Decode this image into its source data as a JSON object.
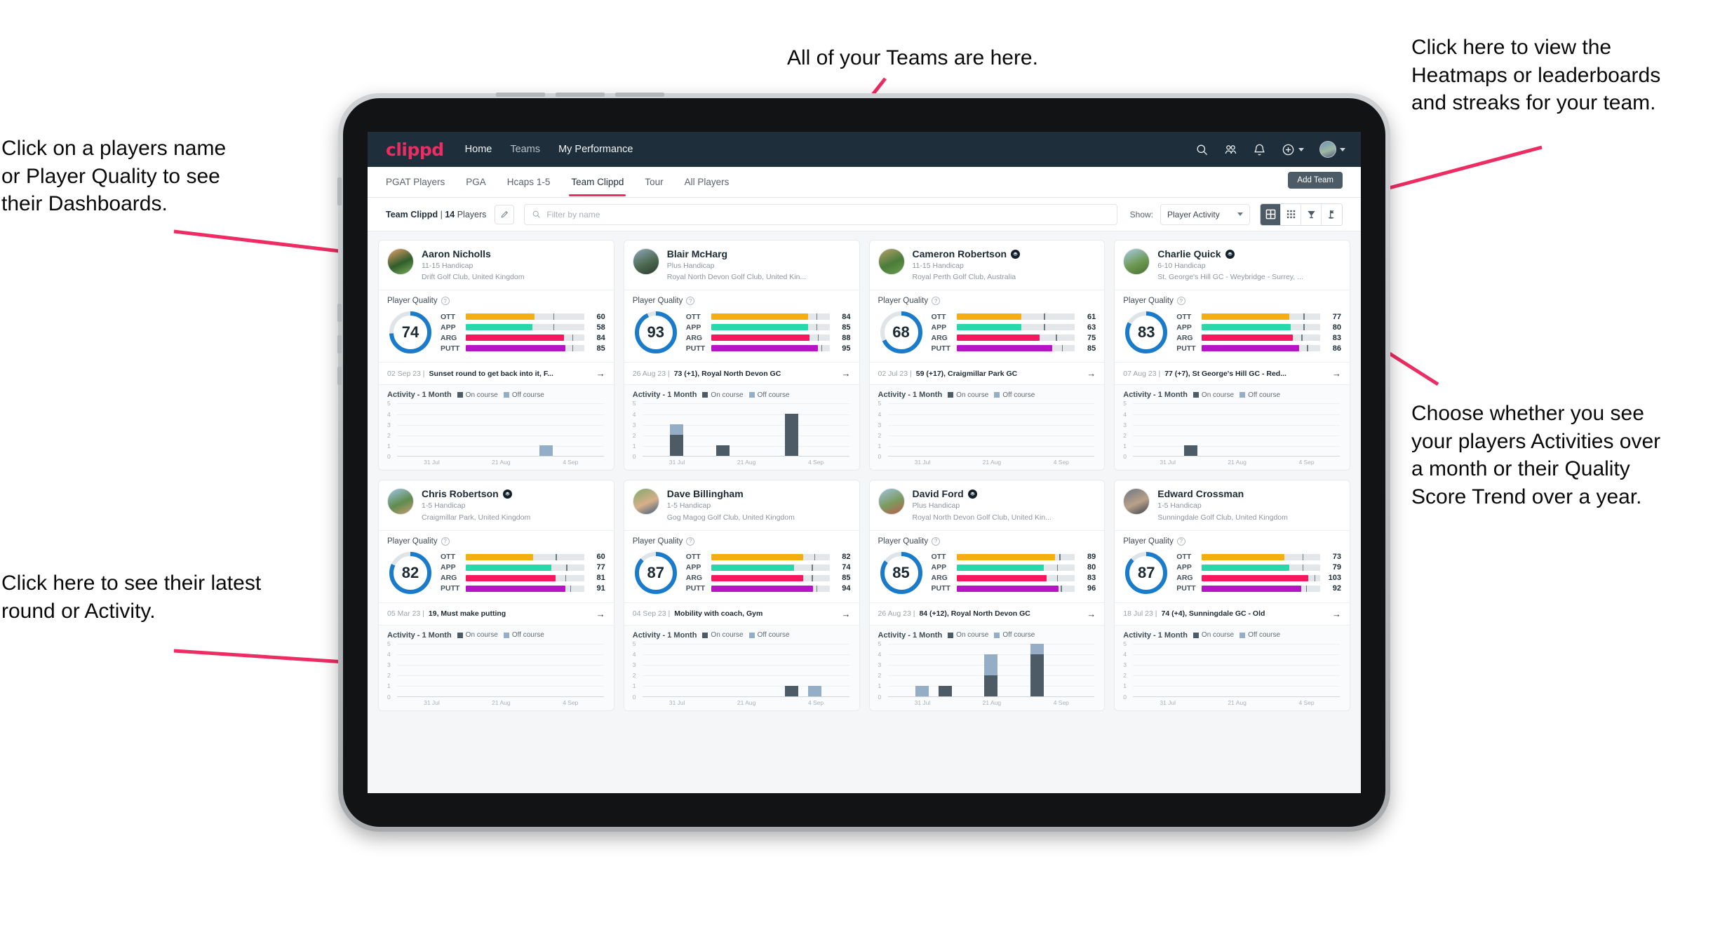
{
  "annotations": {
    "left_top": "Click on a players name\nor Player Quality to see\ntheir Dashboards.",
    "left_bottom": "Click here to see their latest\nround or Activity.",
    "top": "All of your Teams are here.",
    "right_top": "Click here to view the\nHeatmaps or leaderboards\nand streaks for your team.",
    "right_bottom": "Choose whether you see\nyour players Activities over\na month or their Quality\nScore Trend over a year.",
    "arrow_color": "#ec2c62"
  },
  "app": {
    "brand": "clippd",
    "nav_links": [
      {
        "label": "Home",
        "active": true
      },
      {
        "label": "Teams",
        "active": false
      },
      {
        "label": "My Performance",
        "active": false
      }
    ],
    "nav_icons": [
      "search-icon",
      "people-icon",
      "bell-icon",
      "plus-circle-icon",
      "avatar"
    ],
    "tabs": [
      {
        "label": "PGAT Players",
        "active": false
      },
      {
        "label": "PGA",
        "active": false
      },
      {
        "label": "Hcaps 1-5",
        "active": false
      },
      {
        "label": "Team Clippd",
        "active": true
      },
      {
        "label": "Tour",
        "active": false
      },
      {
        "label": "All Players",
        "active": false
      }
    ],
    "add_team_label": "Add Team",
    "filter": {
      "team_name": "Team Clippd",
      "separator": "|",
      "player_count": "14",
      "players_word": "Players",
      "edit_icon": "pencil-icon",
      "search_placeholder": "Filter by name",
      "search_value": "",
      "show_label": "Show:",
      "show_value": "Player Activity",
      "view_toggles": [
        "grid-large-icon",
        "grid-small-icon",
        "shield-icon",
        "flag-icon"
      ],
      "active_view": 0
    },
    "accent_color": "#ec2c62",
    "navbar_color": "#1e2e3b"
  },
  "quality_colors": {
    "OTT": "#f5ae11",
    "APP": "#2ad7ab",
    "ARG": "#f5185e",
    "PUTT": "#b515c4",
    "ring": "#1b7bcb",
    "track": "#e3e7ea"
  },
  "chart_data": {
    "type": "bar",
    "title": "Activity - 1 Month",
    "legend": [
      "On course",
      "Off course"
    ],
    "legend_colors": [
      "#4c5b66",
      "#93aec6"
    ],
    "ylim": [
      0,
      5
    ],
    "yticks": [
      5,
      4,
      3,
      2,
      1,
      0
    ],
    "xlabels": [
      "31 Jul",
      "21 Aug",
      "4 Sep"
    ],
    "bins": 9,
    "grid": true,
    "series_per_player": [
      {
        "player": "Aaron Nicholls",
        "on_course": [
          0,
          0,
          0,
          0,
          0,
          0,
          0,
          0,
          0
        ],
        "off_course": [
          0,
          0,
          0,
          0,
          0,
          0,
          1,
          0,
          0
        ]
      },
      {
        "player": "Blair McHarg",
        "on_course": [
          0,
          2,
          0,
          1,
          0,
          0,
          4,
          0,
          0
        ],
        "off_course": [
          0,
          1,
          0,
          0,
          0,
          0,
          0,
          0,
          0
        ]
      },
      {
        "player": "Cameron Robertson",
        "on_course": [
          0,
          0,
          0,
          0,
          0,
          0,
          0,
          0,
          0
        ],
        "off_course": [
          0,
          0,
          0,
          0,
          0,
          0,
          0,
          0,
          0
        ]
      },
      {
        "player": "Charlie Quick",
        "on_course": [
          0,
          0,
          1,
          0,
          0,
          0,
          0,
          0,
          0
        ],
        "off_course": [
          0,
          0,
          0,
          0,
          0,
          0,
          0,
          0,
          0
        ]
      },
      {
        "player": "Chris Robertson",
        "on_course": [
          0,
          0,
          0,
          0,
          0,
          0,
          0,
          0,
          0
        ],
        "off_course": [
          0,
          0,
          0,
          0,
          0,
          0,
          0,
          0,
          0
        ]
      },
      {
        "player": "Dave Billingham",
        "on_course": [
          0,
          0,
          0,
          0,
          0,
          0,
          1,
          0,
          0
        ],
        "off_course": [
          0,
          0,
          0,
          0,
          0,
          0,
          0,
          1,
          0
        ]
      },
      {
        "player": "David Ford",
        "on_course": [
          0,
          0,
          1,
          0,
          2,
          0,
          4,
          0,
          0
        ],
        "off_course": [
          0,
          1,
          0,
          0,
          2,
          0,
          1,
          0,
          0
        ]
      },
      {
        "player": "Edward Crossman",
        "on_course": [
          0,
          0,
          0,
          0,
          0,
          0,
          0,
          0,
          0
        ],
        "off_course": [
          0,
          0,
          0,
          0,
          0,
          0,
          0,
          0,
          0
        ]
      }
    ]
  },
  "players": [
    {
      "name": "Aaron Nicholls",
      "verified": false,
      "handicap": "11-15 Handicap",
      "club": "Drift Golf Club, United Kingdom",
      "avatar_colors": [
        "#e8a06a",
        "#2f5e2c",
        "#7fae5a"
      ],
      "quality_label": "Player Quality",
      "score": 74,
      "metrics": [
        {
          "label": "OTT",
          "value": 60,
          "fill": 58,
          "tick": 74
        },
        {
          "label": "APP",
          "value": 58,
          "fill": 56,
          "tick": 74
        },
        {
          "label": "ARG",
          "value": 84,
          "fill": 83,
          "tick": 90
        },
        {
          "label": "PUTT",
          "value": 85,
          "fill": 84,
          "tick": 90
        }
      ],
      "last_date": "02 Sep 23 |",
      "last_text": "Sunset round to get back into it, F..."
    },
    {
      "name": "Blair McHarg",
      "verified": false,
      "handicap": "Plus Handicap",
      "club": "Royal North Devon Golf Club, United Kin...",
      "avatar_colors": [
        "#8fa7bb",
        "#4d6a52",
        "#2b3b33"
      ],
      "quality_label": "Player Quality",
      "score": 93,
      "metrics": [
        {
          "label": "OTT",
          "value": 84,
          "fill": 82,
          "tick": 89
        },
        {
          "label": "APP",
          "value": 85,
          "fill": 82,
          "tick": 89
        },
        {
          "label": "ARG",
          "value": 88,
          "fill": 83,
          "tick": 90
        },
        {
          "label": "PUTT",
          "value": 95,
          "fill": 90,
          "tick": 93
        }
      ],
      "last_date": "26 Aug 23 |",
      "last_text": "73 (+1), Royal North Devon GC"
    },
    {
      "name": "Cameron Robertson",
      "verified": true,
      "handicap": "11-15 Handicap",
      "club": "Royal Perth Golf Club, Australia",
      "avatar_colors": [
        "#b8a06a",
        "#4a7c3a",
        "#6d9c4e"
      ],
      "quality_label": "Player Quality",
      "score": 68,
      "metrics": [
        {
          "label": "OTT",
          "value": 61,
          "fill": 55,
          "tick": 74
        },
        {
          "label": "APP",
          "value": 63,
          "fill": 55,
          "tick": 74
        },
        {
          "label": "ARG",
          "value": 75,
          "fill": 70,
          "tick": 84
        },
        {
          "label": "PUTT",
          "value": 85,
          "fill": 81,
          "tick": 89
        }
      ],
      "last_date": "02 Jul 23 |",
      "last_text": "59 (+17), Craigmillar Park GC"
    },
    {
      "name": "Charlie Quick",
      "verified": true,
      "handicap": "6-10 Handicap",
      "club": "St. George's Hill GC - Weybridge - Surrey, ...",
      "avatar_colors": [
        "#a9cbe4",
        "#6d9a55",
        "#47702f"
      ],
      "quality_label": "Player Quality",
      "score": 83,
      "metrics": [
        {
          "label": "OTT",
          "value": 77,
          "fill": 74,
          "tick": 86
        },
        {
          "label": "APP",
          "value": 80,
          "fill": 75,
          "tick": 86
        },
        {
          "label": "ARG",
          "value": 83,
          "fill": 77,
          "tick": 84
        },
        {
          "label": "PUTT",
          "value": 86,
          "fill": 82,
          "tick": 89
        }
      ],
      "last_date": "07 Aug 23 |",
      "last_text": "77 (+7), St George's Hill GC - Red..."
    },
    {
      "name": "Chris Robertson",
      "verified": true,
      "handicap": "1-5 Handicap",
      "club": "Craigmillar Park, United Kingdom",
      "avatar_colors": [
        "#9ec6e8",
        "#5f8c4e",
        "#c79c74"
      ],
      "quality_label": "Player Quality",
      "score": 82,
      "metrics": [
        {
          "label": "OTT",
          "value": 60,
          "fill": 57,
          "tick": 76
        },
        {
          "label": "APP",
          "value": 77,
          "fill": 72,
          "tick": 85
        },
        {
          "label": "ARG",
          "value": 81,
          "fill": 76,
          "tick": 84
        },
        {
          "label": "PUTT",
          "value": 91,
          "fill": 84,
          "tick": 88
        }
      ],
      "last_date": "05 Mar 23 |",
      "last_text": "19, Must make putting"
    },
    {
      "name": "Dave Billingham",
      "verified": false,
      "handicap": "1-5 Handicap",
      "club": "Gog Magog Golf Club, United Kingdom",
      "avatar_colors": [
        "#7fa86a",
        "#d7b08a",
        "#3d5a7a"
      ],
      "quality_label": "Player Quality",
      "score": 87,
      "metrics": [
        {
          "label": "OTT",
          "value": 82,
          "fill": 78,
          "tick": 87
        },
        {
          "label": "APP",
          "value": 74,
          "fill": 70,
          "tick": 85
        },
        {
          "label": "ARG",
          "value": 85,
          "fill": 78,
          "tick": 85
        },
        {
          "label": "PUTT",
          "value": 94,
          "fill": 86,
          "tick": 89
        }
      ],
      "last_date": "04 Sep 23 |",
      "last_text": "Mobility with coach, Gym"
    },
    {
      "name": "David Ford",
      "verified": true,
      "handicap": "Plus Handicap",
      "club": "Royal North Devon Golf Club, United Kin...",
      "avatar_colors": [
        "#9ec3dd",
        "#7b9a5e",
        "#c25a4a"
      ],
      "quality_label": "Player Quality",
      "score": 85,
      "metrics": [
        {
          "label": "OTT",
          "value": 89,
          "fill": 83,
          "tick": 87
        },
        {
          "label": "APP",
          "value": 80,
          "fill": 74,
          "tick": 85
        },
        {
          "label": "ARG",
          "value": 83,
          "fill": 76,
          "tick": 85
        },
        {
          "label": "PUTT",
          "value": 96,
          "fill": 86,
          "tick": 88
        }
      ],
      "last_date": "26 Aug 23 |",
      "last_text": "84 (+12), Royal North Devon GC"
    },
    {
      "name": "Edward Crossman",
      "verified": false,
      "handicap": "1-5 Handicap",
      "club": "Sunningdale Golf Club, United Kingdom",
      "avatar_colors": [
        "#6e7683",
        "#b9a189",
        "#39414c"
      ],
      "quality_label": "Player Quality",
      "score": 87,
      "metrics": [
        {
          "label": "OTT",
          "value": 73,
          "fill": 70,
          "tick": 85
        },
        {
          "label": "APP",
          "value": 79,
          "fill": 74,
          "tick": 85
        },
        {
          "label": "ARG",
          "value": 103,
          "fill": 90,
          "tick": 95
        },
        {
          "label": "PUTT",
          "value": 92,
          "fill": 84,
          "tick": 88
        }
      ],
      "last_date": "18 Jul 23 |",
      "last_text": "74 (+4), Sunningdale GC - Old"
    }
  ]
}
